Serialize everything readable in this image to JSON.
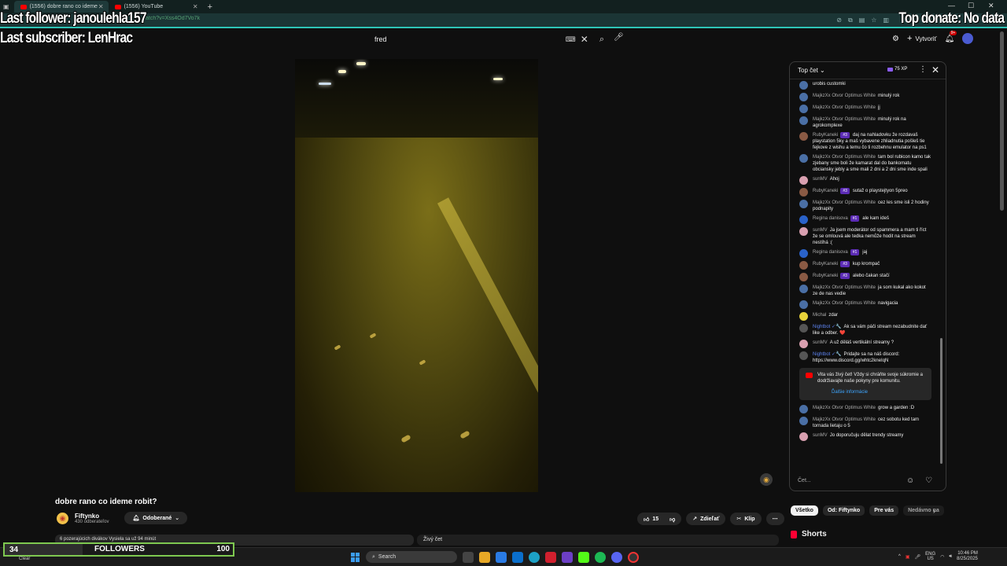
{
  "browser": {
    "tabs": [
      {
        "label": "(1556) dobre rano co ideme"
      },
      {
        "label": "(1556) YouTube"
      }
    ],
    "new_tab": "+",
    "address_partial": "atch?v=Xss4Od7Vo7k",
    "window_min": "—",
    "window_max": "☐",
    "window_close": "✕"
  },
  "overlay": {
    "last_follower": "Last follower: janoulehla157",
    "last_subscriber": "Last subscriber: LenHrac",
    "top_donate": "Top donate: No data"
  },
  "search": {
    "value": "fred"
  },
  "header": {
    "create_label": "Vytvoriť",
    "notif_count": "9+"
  },
  "video": {
    "title": "dobre rano co ideme robit?"
  },
  "channel": {
    "name": "Fiftynko",
    "subscribers": "430 odberateľov",
    "subscribed_label": "Odoberané"
  },
  "actions": {
    "likes": "15",
    "share": "Zdieľať",
    "clip": "Klip"
  },
  "description_line": "6 pozerajúcich divákov  Vysiela sa už 94 minút",
  "live_chat_label": "Živý čet",
  "chat": {
    "header_label": "Top čet",
    "xp": "75 XP",
    "messages": [
      {
        "author": "",
        "text": "urobis customki",
        "badge": "",
        "mod": false,
        "avatar": "#4a6fa5"
      },
      {
        "author": "MajkzXx Otvor Optimus White",
        "text": "minulý rok",
        "badge": "",
        "mod": false,
        "avatar": "#4a6fa5"
      },
      {
        "author": "MajkzXx Otvor Optimus White",
        "text": "jj",
        "badge": "",
        "mod": false,
        "avatar": "#4a6fa5"
      },
      {
        "author": "MajkzXx Otvor Optimus White",
        "text": "minulý rok na agrokomplexe",
        "badge": "",
        "mod": false,
        "avatar": "#4a6fa5"
      },
      {
        "author": "RubyKaneki",
        "text": "daj na nahladovku že rozdavaš playstation 5ky a maš vybavene zhliadnutia pošleš tie fejkove z wishu a temu čo ti rozbehnu emulator na ps1",
        "badge": "#3",
        "mod": false,
        "avatar": "#8a5a44"
      },
      {
        "author": "MajkzXx Otvor Optimus White",
        "text": "tam bol rubicon kamo tak zjebany sme boli že kamarat dal do bankomatu obciansky jebly a sme mali 2 dni a 2 dni sme inde spali",
        "badge": "",
        "mod": false,
        "avatar": "#4a6fa5"
      },
      {
        "author": "sunMV",
        "text": "Ahoj",
        "badge": "",
        "mod": false,
        "avatar": "#d9a0b0"
      },
      {
        "author": "RubyKaneki",
        "text": "sutaž o playstejtyon 5preo",
        "badge": "#3",
        "mod": false,
        "avatar": "#8a5a44"
      },
      {
        "author": "MajkzXx Otvor Optimus White",
        "text": "cez les sme isli 2 hodiny podnapity",
        "badge": "",
        "mod": false,
        "avatar": "#4a6fa5"
      },
      {
        "author": "Regina danisova",
        "text": "ale kam ideš",
        "badge": "#1",
        "mod": false,
        "avatar": "#2a62c9"
      },
      {
        "author": "sunMV",
        "text": "Ja jsem moderátor od spammera a mam ti říct že se omlouvá ale tedka nemůže hodit na stream nestíhá :(",
        "badge": "",
        "mod": false,
        "avatar": "#d9a0b0"
      },
      {
        "author": "Regina danisova",
        "text": "jaj",
        "badge": "#1",
        "mod": false,
        "avatar": "#2a62c9"
      },
      {
        "author": "RubyKaneki",
        "text": "kup krompač",
        "badge": "#3",
        "mod": false,
        "avatar": "#8a5a44"
      },
      {
        "author": "RubyKaneki",
        "text": "alebo čakan stačí",
        "badge": "#3",
        "mod": false,
        "avatar": "#8a5a44"
      },
      {
        "author": "MajkzXx Otvor Optimus White",
        "text": "ja som kukal ako kokot ze de nas vedie",
        "badge": "",
        "mod": false,
        "avatar": "#4a6fa5"
      },
      {
        "author": "MajkzXx Otvor Optimus White",
        "text": "navigacia",
        "badge": "",
        "mod": false,
        "avatar": "#4a6fa5"
      },
      {
        "author": "Michal",
        "text": "zdar",
        "badge": "",
        "mod": false,
        "avatar": "#e8d33a"
      },
      {
        "author": "Nightbot ✓🔧",
        "text": "Ak sa vám páči stream nezabudnite dať like a odber. ❤️",
        "badge": "",
        "mod": true,
        "avatar": "#555555"
      },
      {
        "author": "sunMV",
        "text": "A už děláš vertikální streamy ?",
        "badge": "",
        "mod": false,
        "avatar": "#d9a0b0"
      },
      {
        "author": "Nightbot ✓🔧",
        "text": "Pridajte sa na náš discord: https://www.discord.gg/whtc2kneIqN",
        "badge": "",
        "mod": true,
        "avatar": "#555555"
      }
    ],
    "notice_text": "Vita vás živý čet! Vždy si chráňte svoje súkromie a dodržiavajte naše pokyny pre komunitu.",
    "notice_link": "Ďalšie informácie",
    "messages_after": [
      {
        "author": "MajkzXx Otvor Optimus White",
        "text": "grow a garden :D",
        "avatar": "#4a6fa5"
      },
      {
        "author": "MajkzXx Otvor Optimus White",
        "text": "cez sobotu ked tam tornada lietaju o 5",
        "avatar": "#4a6fa5"
      },
      {
        "author": "sunMV",
        "text": "Jo doporučuju dělat trendy streamy",
        "avatar": "#d9a0b0"
      }
    ],
    "input_placeholder": "Čet..."
  },
  "chips": [
    "Všetko",
    "Od: Fiftynko",
    "Pre vás",
    "Nedávno na"
  ],
  "shorts_label": "Shorts",
  "followers_bar": {
    "current": "34",
    "label": "FOLLOWERS",
    "goal": "100",
    "progress": 0.34
  },
  "weather": "Clear",
  "taskbar": {
    "search_label": "Search",
    "lang_1": "ENG",
    "lang_2": "US",
    "time": "10:46 PM",
    "date": "8/25/2025"
  },
  "colors": {
    "accent_teal": "#2ec4b6",
    "yt_red": "#ff0000",
    "bar_green": "#7ec850",
    "member_badge": "#5b2bb5"
  }
}
